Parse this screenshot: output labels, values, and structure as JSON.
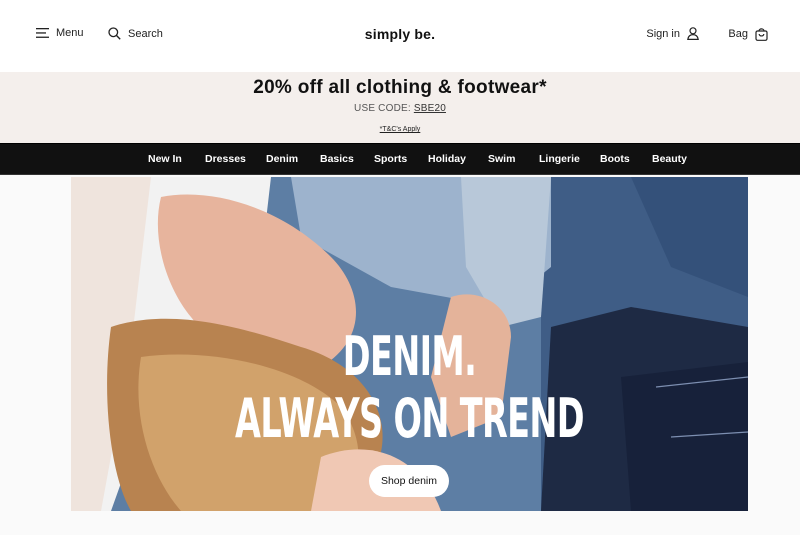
{
  "header": {
    "menu_label": "Menu",
    "search_label": "Search",
    "logo_text": "simply be.",
    "signin_label": "Sign in",
    "bag_label": "Bag"
  },
  "promo": {
    "title": "20% off all clothing & footwear*",
    "code_prefix": "USE CODE:",
    "code": "SBE20",
    "terms": "*T&C's Apply"
  },
  "nav": {
    "items": [
      "New In",
      "Dresses",
      "Denim",
      "Basics",
      "Sports",
      "Holiday",
      "Swim",
      "Lingerie",
      "Boots",
      "Beauty"
    ]
  },
  "hero": {
    "headline_line1": "DENIM.",
    "headline_line2": "ALWAYS ON TREND",
    "cta_label": "Shop denim"
  },
  "icons": {
    "menu": "hamburger-icon",
    "search": "search-icon",
    "signin": "user-icon",
    "bag": "shopping-bag-icon"
  },
  "colors": {
    "promo_bg": "#f4efec",
    "nav_bg": "#111111",
    "header_bg": "#ffffff"
  }
}
